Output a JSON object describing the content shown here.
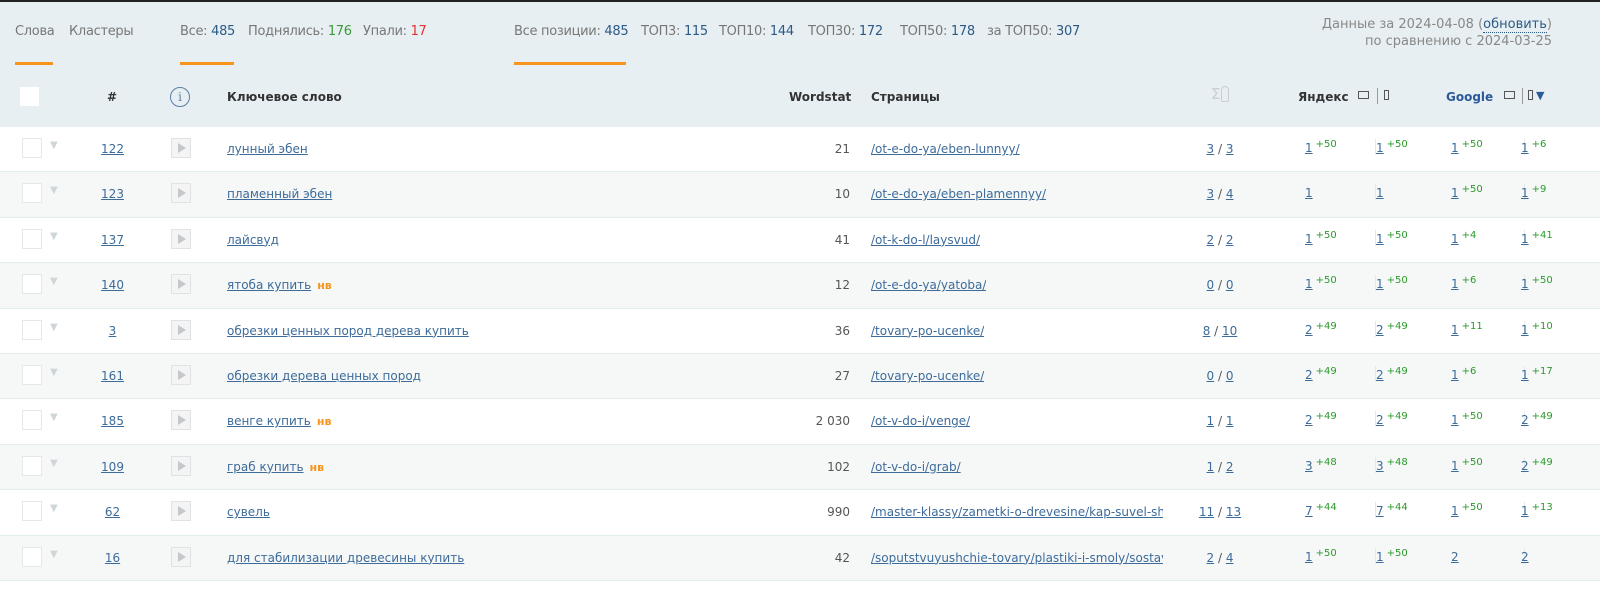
{
  "tabs": {
    "words": "Слова",
    "clusters": "Кластеры"
  },
  "filters": {
    "all_label": "Все:",
    "all": "485",
    "up_label": "Поднялись:",
    "up": "176",
    "down_label": "Упали:",
    "down": "17"
  },
  "positions": {
    "all_label": "Все позиции:",
    "all": "485",
    "top3_label": "ТОП3:",
    "top3": "115",
    "top10_label": "ТОП10:",
    "top10": "144",
    "top30_label": "ТОП30:",
    "top30": "172",
    "top50_label": "ТОП50:",
    "top50": "178",
    "over50_label": "за ТОП50:",
    "over50": "307"
  },
  "info": {
    "date_prefix": "Данные за 2024-04-08 (",
    "refresh": "обновить",
    "date_suffix": ")",
    "compare": "по сравнению с 2024-03-25"
  },
  "columns": {
    "num": "#",
    "keyword": "Ключевое слово",
    "wordstat": "Wordstat",
    "pages": "Страницы",
    "sum": "Σ",
    "yandex": "Яндекс",
    "google": "Google"
  },
  "colors": {
    "accent": "#f7941d",
    "link": "#3d6b9a",
    "up": "#2a9a2a",
    "down": "#e53333",
    "header_bg": "#e8eff2"
  },
  "rows": [
    {
      "num": "122",
      "kw": "лунный эбен",
      "nv": "",
      "ws": "21",
      "page": "/ot-e-do-ya/eben-lunnyy/",
      "s1": "3",
      "s2": "3",
      "yd": "1",
      "ydd": "+50",
      "ym": "1",
      "ymd": "+50",
      "gd": "1",
      "gdd": "+50",
      "gm": "1",
      "gmd": "+6"
    },
    {
      "num": "123",
      "kw": "пламенный эбен",
      "nv": "",
      "ws": "10",
      "page": "/ot-e-do-ya/eben-plamennyy/",
      "s1": "3",
      "s2": "4",
      "yd": "1",
      "ydd": "",
      "ym": "1",
      "ymd": "",
      "gd": "1",
      "gdd": "+50",
      "gm": "1",
      "gmd": "+9"
    },
    {
      "num": "137",
      "kw": "лайсвуд",
      "nv": "",
      "ws": "41",
      "page": "/ot-k-do-l/laysvud/",
      "s1": "2",
      "s2": "2",
      "yd": "1",
      "ydd": "+50",
      "ym": "1",
      "ymd": "+50",
      "gd": "1",
      "gdd": "+4",
      "gm": "1",
      "gmd": "+41"
    },
    {
      "num": "140",
      "kw": "ятоба купить",
      "nv": "нв",
      "ws": "12",
      "page": "/ot-e-do-ya/yatoba/",
      "s1": "0",
      "s2": "0",
      "yd": "1",
      "ydd": "+50",
      "ym": "1",
      "ymd": "+50",
      "gd": "1",
      "gdd": "+6",
      "gm": "1",
      "gmd": "+50"
    },
    {
      "num": "3",
      "kw": "обрезки ценных пород дерева купить",
      "nv": "",
      "ws": "36",
      "page": "/tovary-po-ucenke/",
      "s1": "8",
      "s2": "10",
      "yd": "2",
      "ydd": "+49",
      "ym": "2",
      "ymd": "+49",
      "gd": "1",
      "gdd": "+11",
      "gm": "1",
      "gmd": "+10"
    },
    {
      "num": "161",
      "kw": "обрезки дерева ценных пород",
      "nv": "",
      "ws": "27",
      "page": "/tovary-po-ucenke/",
      "s1": "0",
      "s2": "0",
      "yd": "2",
      "ydd": "+49",
      "ym": "2",
      "ymd": "+49",
      "gd": "1",
      "gdd": "+6",
      "gm": "1",
      "gmd": "+17"
    },
    {
      "num": "185",
      "kw": "венге купить",
      "nv": "нв",
      "ws": "2 030",
      "page": "/ot-v-do-i/venge/",
      "s1": "1",
      "s2": "1",
      "yd": "2",
      "ydd": "+49",
      "ym": "2",
      "ymd": "+49",
      "gd": "1",
      "gdd": "+50",
      "gm": "2",
      "gmd": "+49"
    },
    {
      "num": "109",
      "kw": "граб купить",
      "nv": "нв",
      "ws": "102",
      "page": "/ot-v-do-i/grab/",
      "s1": "1",
      "s2": "2",
      "yd": "3",
      "ydd": "+48",
      "ym": "3",
      "ymd": "+48",
      "gd": "1",
      "gdd": "+50",
      "gm": "2",
      "gmd": "+49"
    },
    {
      "num": "62",
      "kw": "сувель",
      "nv": "",
      "ws": "990",
      "page": "/master-klassy/zametki-o-drevesine/kap-suvel-shp...",
      "s1": "11",
      "s2": "13",
      "yd": "7",
      "ydd": "+44",
      "ym": "7",
      "ymd": "+44",
      "gd": "1",
      "gdd": "+50",
      "gm": "1",
      "gmd": "+13"
    },
    {
      "num": "16",
      "kw": "для стабилизации древесины купить",
      "nv": "",
      "ws": "42",
      "page": "/soputstvuyushchie-tovary/plastiki-i-smoly/sostavy...",
      "s1": "2",
      "s2": "4",
      "yd": "1",
      "ydd": "+50",
      "ym": "1",
      "ymd": "+50",
      "gd": "2",
      "gdd": "",
      "gm": "2",
      "gmd": ""
    }
  ]
}
